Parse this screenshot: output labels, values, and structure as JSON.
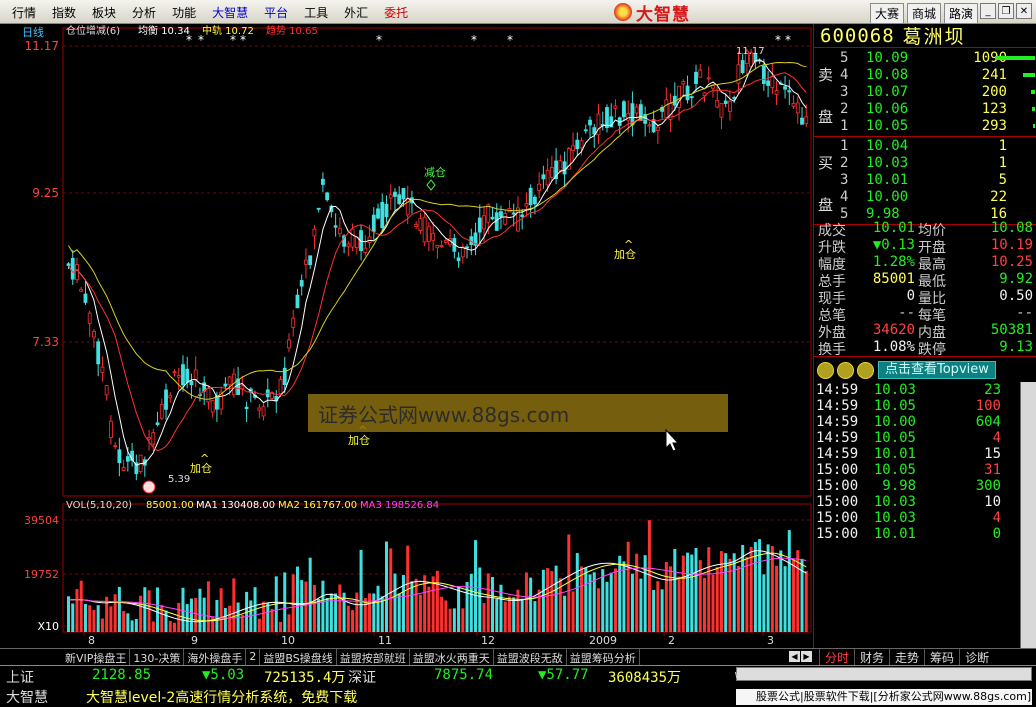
{
  "menu": {
    "items": [
      {
        "label": "行情",
        "style": "normal"
      },
      {
        "label": "指数",
        "style": "normal"
      },
      {
        "label": "板块",
        "style": "normal"
      },
      {
        "label": "分析",
        "style": "normal"
      },
      {
        "label": "功能",
        "style": "normal"
      },
      {
        "label": "大智慧",
        "style": "blue"
      },
      {
        "label": "平台",
        "style": "blue"
      },
      {
        "label": "工具",
        "style": "normal"
      },
      {
        "label": "外汇",
        "style": "normal"
      },
      {
        "label": "委托",
        "style": "red"
      }
    ],
    "brand": "大智慧",
    "right_buttons": [
      "大赛",
      "商城",
      "路演"
    ]
  },
  "chart": {
    "period_label": "日线",
    "indicator_line": {
      "name": "仓位增减(6)",
      "items": [
        {
          "label": "均衡",
          "value": "10.34",
          "color": "#ffffff"
        },
        {
          "label": "中轨",
          "value": "10.72",
          "color": "#ffff40"
        },
        {
          "label": "趋势",
          "value": "10.65",
          "color": "#ff3030"
        }
      ]
    },
    "price_ticks": [
      "11.17",
      "9.25",
      "7.33"
    ],
    "annotations": {
      "reduce": "减仓",
      "add1": "加仓",
      "add2": "加仓",
      "add3": "加仓",
      "high": "11.17",
      "low": "5.39"
    },
    "watermark": "证券公式网www.88gs.com",
    "vol_line": {
      "name": "VOL(5,10,20)",
      "value": "85001.00",
      "items": [
        {
          "label": "MA1",
          "value": "130408.00",
          "color": "#ffffff"
        },
        {
          "label": "MA2",
          "value": "161767.00",
          "color": "#ffff40"
        },
        {
          "label": "MA3",
          "value": "198526.84",
          "color": "#ff40ff"
        }
      ]
    },
    "vol_ticks": [
      "39504",
      "19752",
      "X10"
    ],
    "x_labels": [
      "8",
      "9",
      "10",
      "11",
      "12",
      "2009",
      "2",
      "3"
    ],
    "colors": {
      "up": "#ff3030",
      "down": "#40e0e0",
      "grid": "#7a0000"
    }
  },
  "quote": {
    "code": "600068",
    "name": "葛洲坝",
    "sell_label": [
      "卖",
      "盘"
    ],
    "buy_label": [
      "买",
      "盘"
    ],
    "asks": [
      {
        "level": "5",
        "price": "10.09",
        "vol": "1090"
      },
      {
        "level": "4",
        "price": "10.08",
        "vol": "241"
      },
      {
        "level": "3",
        "price": "10.07",
        "vol": "200"
      },
      {
        "level": "2",
        "price": "10.06",
        "vol": "123"
      },
      {
        "level": "1",
        "price": "10.05",
        "vol": "293"
      }
    ],
    "bids": [
      {
        "level": "1",
        "price": "10.04",
        "vol": "1"
      },
      {
        "level": "2",
        "price": "10.03",
        "vol": "1"
      },
      {
        "level": "3",
        "price": "10.01",
        "vol": "5"
      },
      {
        "level": "4",
        "price": "10.00",
        "vol": "22"
      },
      {
        "level": "5",
        "price": "9.98",
        "vol": "16"
      }
    ],
    "stats": [
      {
        "l1": "成交",
        "v1": "10.01",
        "l2": "均价",
        "v2": "10.08",
        "c1": "green",
        "c2": "green"
      },
      {
        "l1": "升跌",
        "v1": "▼0.13",
        "l2": "开盘",
        "v2": "10.19",
        "c1": "green",
        "c2": "red"
      },
      {
        "l1": "幅度",
        "v1": "1.28%",
        "l2": "最高",
        "v2": "10.25",
        "c1": "green",
        "c2": "red"
      },
      {
        "l1": "总手",
        "v1": "85001",
        "l2": "最低",
        "v2": "9.92",
        "c1": "yellow",
        "c2": "green"
      },
      {
        "l1": "现手",
        "v1": "0",
        "l2": "量比",
        "v2": "0.50",
        "c1": "white",
        "c2": "white"
      },
      {
        "l1": "总笔",
        "v1": "--",
        "l2": "每笔",
        "v2": "--",
        "c1": "grey",
        "c2": "grey"
      },
      {
        "l1": "外盘",
        "v1": "34620",
        "l2": "内盘",
        "v2": "50381",
        "c1": "red",
        "c2": "green"
      },
      {
        "l1": "换手",
        "v1": "1.08%",
        "l2": "跌停",
        "v2": "9.13",
        "c1": "white",
        "c2": "green"
      }
    ],
    "topview_button": "点击查看Topview",
    "ticks": [
      {
        "time": "14:59",
        "price": "10.03",
        "vol": "23",
        "vc": "green"
      },
      {
        "time": "14:59",
        "price": "10.05",
        "vol": "100",
        "vc": "red"
      },
      {
        "time": "14:59",
        "price": "10.00",
        "vol": "604",
        "vc": "green"
      },
      {
        "time": "14:59",
        "price": "10.05",
        "vol": "4",
        "vc": "red"
      },
      {
        "time": "14:59",
        "price": "10.01",
        "vol": "15",
        "vc": "white"
      },
      {
        "time": "15:00",
        "price": "10.05",
        "vol": "31",
        "vc": "red"
      },
      {
        "time": "15:00",
        "price": "9.98",
        "vol": "300",
        "vc": "green"
      },
      {
        "time": "15:00",
        "price": "10.03",
        "vol": "10",
        "vc": "white"
      },
      {
        "time": "15:00",
        "price": "10.03",
        "vol": "4",
        "vc": "red"
      },
      {
        "time": "15:00",
        "price": "10.01",
        "vol": "0",
        "vc": "green"
      }
    ]
  },
  "tabs": {
    "left": [
      "新VIP操盘王",
      "130-决策",
      "海外操盘手",
      "2",
      "益盟BS操盘线",
      "益盟按部就班",
      "益盟冰火两重天",
      "益盟波段无敌",
      "益盟筹码分析"
    ],
    "right": [
      "分时",
      "财务",
      "走势",
      "筹码",
      "诊断"
    ]
  },
  "status": {
    "sh_label": "上证",
    "sh_value": "2128.85",
    "sh_change": "▼5.03",
    "sh_amount": "725135.4万",
    "sz_label": "深证",
    "sz_value": "7875.74",
    "sz_change": "▼57.77",
    "sz_amount": "3608435万",
    "url": "www.gw.com.cn",
    "bottom_left": "大智慧",
    "marquee": "大智慧level-2高速行情分析系统，免费下载",
    "ad": "股票公式|股票软件下载|[分析家公式网www.88gs.com]"
  }
}
